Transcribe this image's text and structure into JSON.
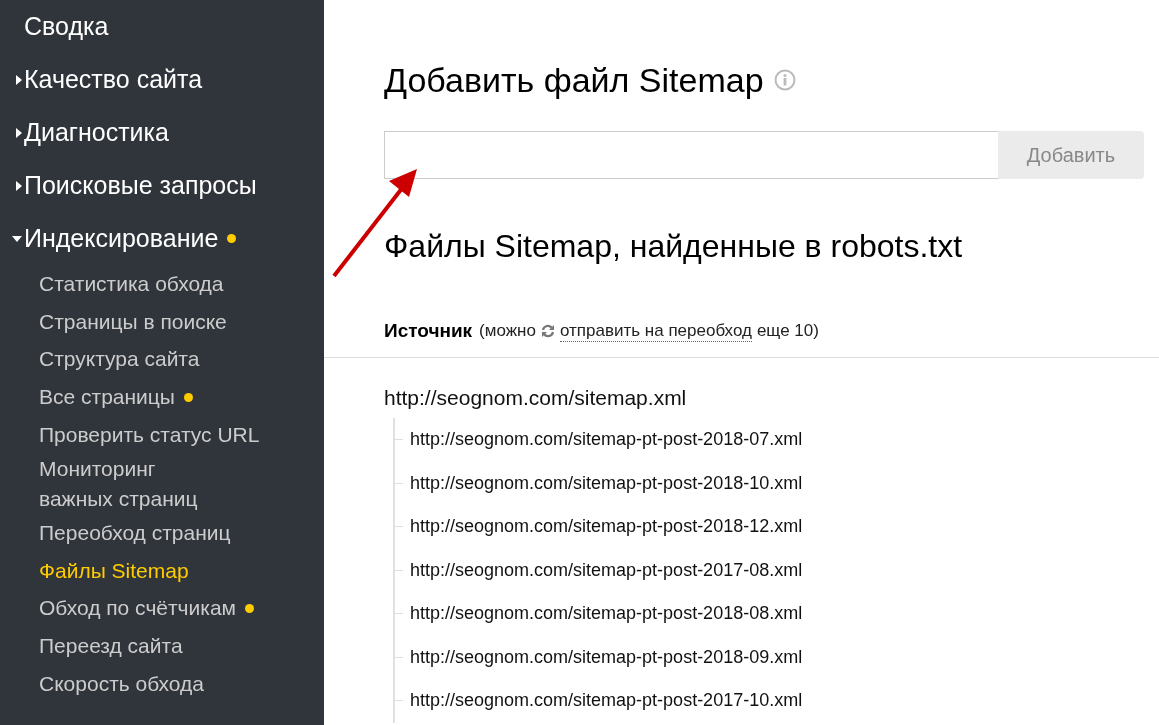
{
  "sidebar": {
    "items": [
      {
        "label": "Сводка",
        "kind": "link",
        "dot": false
      },
      {
        "label": "Качество сайта",
        "kind": "section",
        "expanded": false,
        "dot": false
      },
      {
        "label": "Диагностика",
        "kind": "section",
        "expanded": false,
        "dot": false
      },
      {
        "label": "Поисковые запросы",
        "kind": "section",
        "expanded": false,
        "dot": false
      },
      {
        "label": "Индексирование",
        "kind": "section",
        "expanded": true,
        "dot": true,
        "children": [
          {
            "label": "Статистика обхода",
            "selected": false,
            "dot": false
          },
          {
            "label": "Страницы в поиске",
            "selected": false,
            "dot": false
          },
          {
            "label": "Структура сайта",
            "selected": false,
            "dot": false
          },
          {
            "label": "Все страницы",
            "selected": false,
            "dot": true
          },
          {
            "label": "Проверить статус URL",
            "selected": false,
            "dot": false
          },
          {
            "label": "Мониторинг\nважных страниц",
            "selected": false,
            "dot": false
          },
          {
            "label": "Переобход страниц",
            "selected": false,
            "dot": false
          },
          {
            "label": "Файлы Sitemap",
            "selected": true,
            "dot": false
          },
          {
            "label": "Обход по счётчикам",
            "selected": false,
            "dot": true
          },
          {
            "label": "Переезд сайта",
            "selected": false,
            "dot": false
          },
          {
            "label": "Скорость обхода",
            "selected": false,
            "dot": false
          }
        ]
      }
    ]
  },
  "add_form": {
    "title": "Добавить файл Sitemap",
    "button": {
      "label": "Добавить",
      "disabled": true
    }
  },
  "found": {
    "title": "Файлы Sitemap, найденные в robots.txt",
    "source": {
      "label": "Источник",
      "note_before": "(можно",
      "link": "отправить на переобход",
      "note_after": "еще 10)"
    },
    "tree": [
      {
        "url": "http://seognom.com/sitemap.xml",
        "children": [
          {
            "url": "http://seognom.com/sitemap-pt-post-2018-07.xml"
          },
          {
            "url": "http://seognom.com/sitemap-pt-post-2018-10.xml"
          },
          {
            "url": "http://seognom.com/sitemap-pt-post-2018-12.xml"
          },
          {
            "url": "http://seognom.com/sitemap-pt-post-2017-08.xml"
          },
          {
            "url": "http://seognom.com/sitemap-pt-post-2018-08.xml"
          },
          {
            "url": "http://seognom.com/sitemap-pt-post-2018-09.xml"
          },
          {
            "url": "http://seognom.com/sitemap-pt-post-2017-10.xml"
          }
        ]
      }
    ]
  }
}
